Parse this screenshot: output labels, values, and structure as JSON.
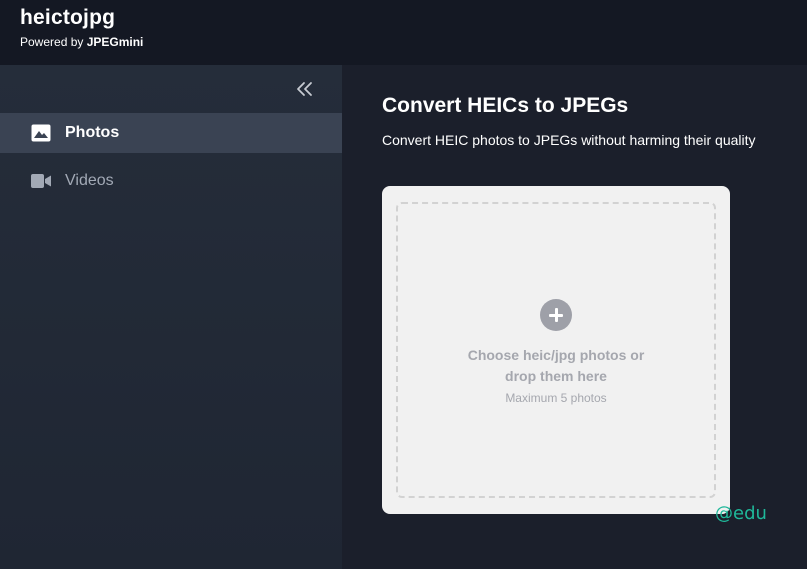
{
  "header": {
    "app_title": "heictojpg",
    "powered_prefix": "Powered by ",
    "powered_brand": "JPEGmini"
  },
  "sidebar": {
    "collapse_icon": "double-chevron-left-icon",
    "items": [
      {
        "label": "Photos",
        "icon": "image-icon",
        "active": true
      },
      {
        "label": "Videos",
        "icon": "video-camera-icon",
        "active": false
      }
    ]
  },
  "main": {
    "title": "Convert HEICs to JPEGs",
    "subtitle": "Convert HEIC photos to JPEGs without harming their quality",
    "dropzone": {
      "icon": "plus-circle-icon",
      "line1": "Choose heic/jpg photos or",
      "line2": "drop them here",
      "hint": "Maximum 5 photos"
    }
  },
  "watermark": "@edu",
  "colors": {
    "header_bg": "#141823",
    "sidebar_bg": "#252d3a",
    "active_item_bg": "#3a4353",
    "main_bg": "#1b1f2b",
    "card_bg": "#f1f1f1",
    "watermark": "#1fb89a"
  }
}
